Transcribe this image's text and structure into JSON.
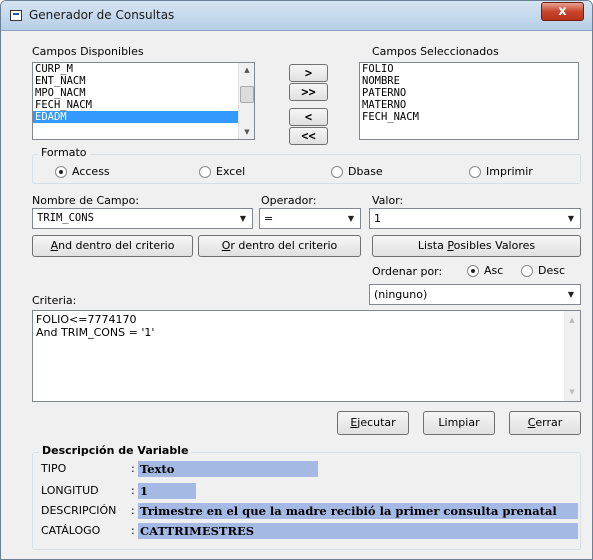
{
  "window": {
    "title": "Generador de Consultas",
    "close_glyph": "x"
  },
  "available": {
    "label": "Campos Disponibles",
    "items": [
      "CURP_M",
      "ENT_NACM",
      "MPO_NACM",
      "FECH_NACM",
      "EDADM"
    ],
    "selected_index": 4
  },
  "transfer": {
    "add_one": ">",
    "add_all": ">>",
    "remove_one": "<",
    "remove_all": "<<"
  },
  "selected": {
    "label": "Campos Seleccionados",
    "items": [
      "FOLIO",
      "NOMBRE",
      "PATERNO",
      "MATERNO",
      "FECH_NACM"
    ]
  },
  "formato": {
    "label": "Formato",
    "options": [
      {
        "label": "Access",
        "checked": true
      },
      {
        "label": "Excel",
        "checked": false
      },
      {
        "label": "Dbase",
        "checked": false
      },
      {
        "label": "Imprimir",
        "checked": false
      }
    ]
  },
  "filter": {
    "field_label": "Nombre de Campo:",
    "field_value": "TRIM_CONS",
    "operator_label": "Operador:",
    "operator_value": "=",
    "value_label": "Valor:",
    "value_value": "1"
  },
  "buttons": {
    "and_rest": "nd dentro del criterio",
    "and_key": "A",
    "or_rest": "r dentro del criterio",
    "or_key": "O",
    "lista_pre": "Lista ",
    "lista_key": "P",
    "lista_rest": "osibles Valores",
    "ejecutar_key": "E",
    "ejecutar_rest": "jecutar",
    "limpiar": "Limpiar",
    "cerrar_key": "C",
    "cerrar_rest": "errar"
  },
  "sort": {
    "label": "Ordenar por:",
    "asc": "Asc",
    "desc": "Desc",
    "asc_checked": true,
    "combo_value": "(ninguno)"
  },
  "criteria": {
    "label": "Criteria:",
    "lines": [
      "FOLIO<=7774170",
      "And TRIM_CONS = '1'"
    ]
  },
  "description": {
    "title": "Descripción de Variable",
    "rows": [
      {
        "key": "TIPO",
        "value": "Texto"
      },
      {
        "key": "LONGITUD",
        "value": "1"
      },
      {
        "key": "DESCRIPCIÓN",
        "value": "Trimestre en el que la madre recibió la primer consulta prenatal"
      },
      {
        "key": "CATÁLOGO",
        "value": "CATTRIMESTRES"
      }
    ]
  },
  "icons": [
    "app-icon",
    "close-icon",
    "scroll-up-icon",
    "scroll-down-icon",
    "dropdown-arrow-icon",
    "radio-icon"
  ]
}
